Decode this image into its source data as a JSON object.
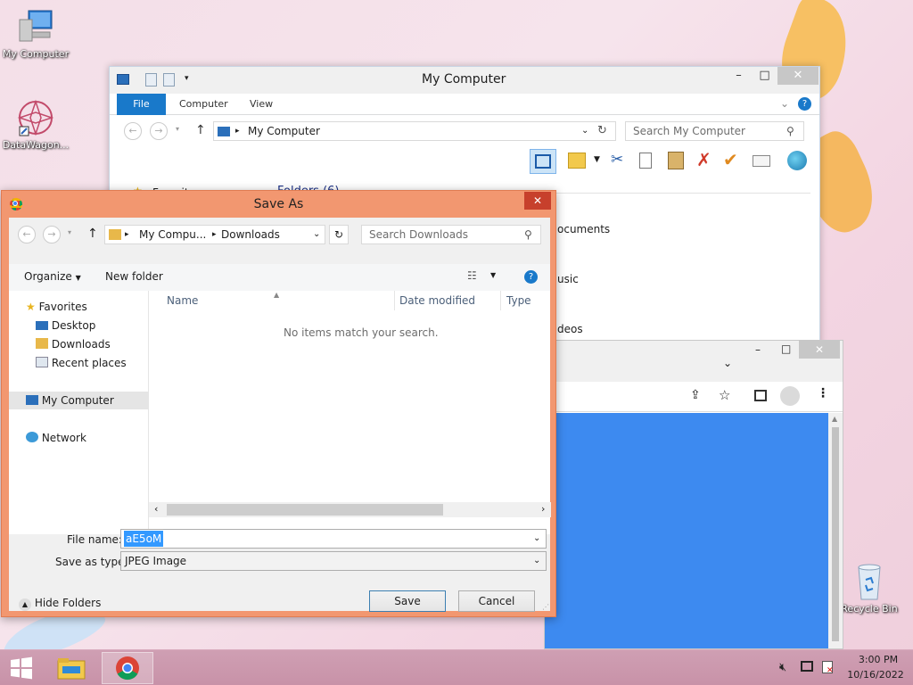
{
  "desktop": {
    "icons": [
      {
        "label": "My Computer"
      },
      {
        "label": "DataWagon..."
      },
      {
        "label": "Recycle Bin"
      }
    ]
  },
  "explorer": {
    "title": "My Computer",
    "ribbon_tabs": [
      "File",
      "Computer",
      "View"
    ],
    "address": "My Computer",
    "search_placeholder": "Search My Computer",
    "nav_partial": "Favorit",
    "folders_header": "Folders (6)",
    "items_partial": [
      "ocuments",
      "usic",
      "deos"
    ]
  },
  "dialog": {
    "title": "Save As",
    "breadcrumb": [
      "My Compu...",
      "Downloads"
    ],
    "search_placeholder": "Search Downloads",
    "organize_label": "Organize",
    "new_folder_label": "New folder",
    "sidebar": {
      "favorites": "Favorites",
      "desktop": "Desktop",
      "downloads": "Downloads",
      "recent": "Recent places",
      "computer": "My Computer",
      "network": "Network"
    },
    "columns": [
      "Name",
      "Date modified",
      "Type"
    ],
    "empty_message": "No items match your search.",
    "file_name_label": "File name:",
    "file_name_value": "aE5oM",
    "save_type_label": "Save as type:",
    "save_type_value": "JPEG Image",
    "hide_folders_label": "Hide Folders",
    "save_button": "Save",
    "cancel_button": "Cancel"
  },
  "taskbar": {
    "time": "3:00 PM",
    "date": "10/16/2022"
  },
  "colors": {
    "accent_blue": "#1979ca",
    "dialog_frame": "#f29770",
    "chrome_content": "#3d8af0"
  }
}
